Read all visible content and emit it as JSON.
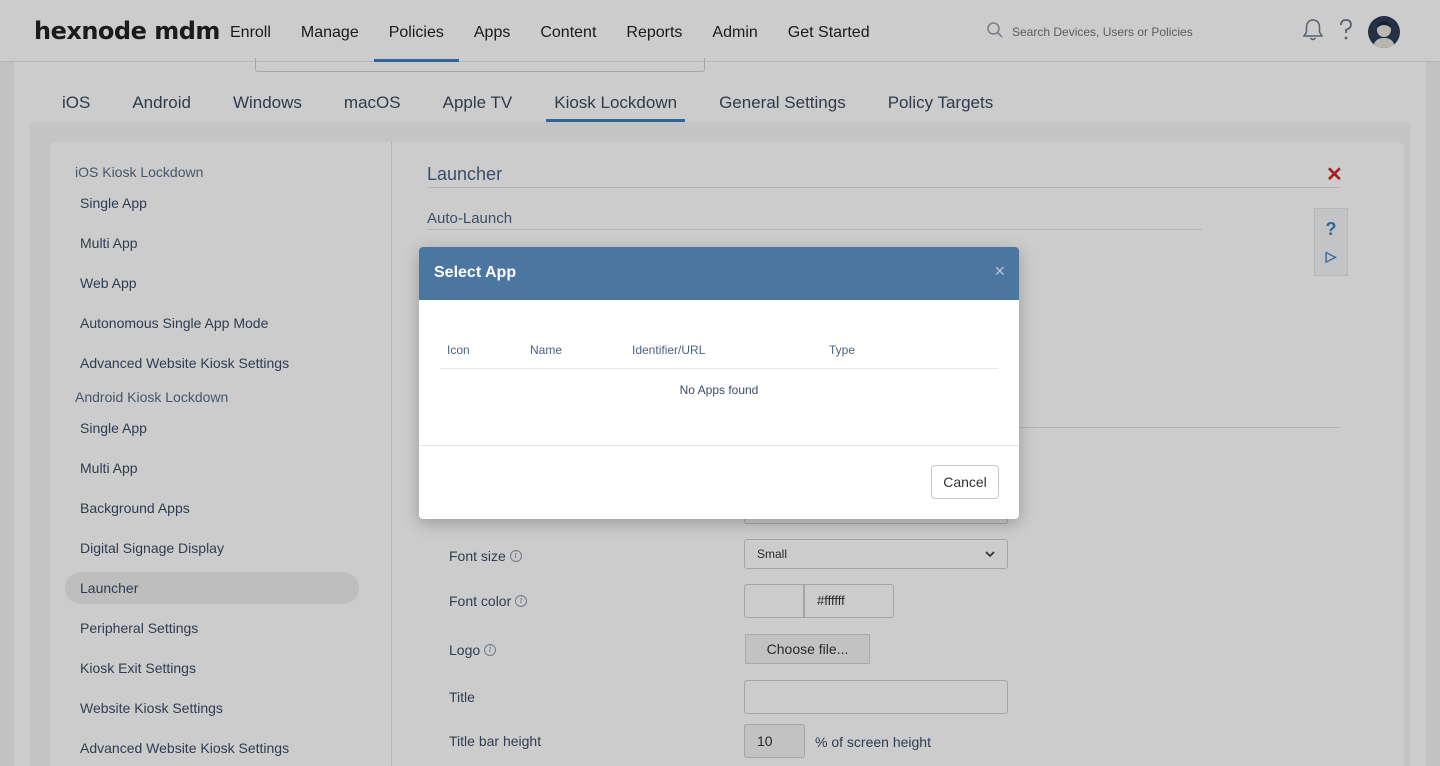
{
  "brand": {
    "logo_text": "hexnode mdm"
  },
  "nav": {
    "items": [
      {
        "label": "Enroll"
      },
      {
        "label": "Manage"
      },
      {
        "label": "Policies",
        "active": true
      },
      {
        "label": "Apps"
      },
      {
        "label": "Content"
      },
      {
        "label": "Reports"
      },
      {
        "label": "Admin"
      },
      {
        "label": "Get Started"
      }
    ],
    "search_placeholder": "Search Devices, Users or Policies",
    "icons": [
      "search-icon",
      "bell-icon",
      "help-icon",
      "avatar"
    ]
  },
  "tabs": [
    {
      "label": "iOS"
    },
    {
      "label": "Android"
    },
    {
      "label": "Windows"
    },
    {
      "label": "macOS"
    },
    {
      "label": "Apple TV"
    },
    {
      "label": "Kiosk Lockdown",
      "active": true
    },
    {
      "label": "General Settings"
    },
    {
      "label": "Policy Targets"
    }
  ],
  "sidebar": {
    "ios_group": "iOS Kiosk Lockdown",
    "ios_items": [
      "Single App",
      "Multi App",
      "Web App",
      "Autonomous Single App Mode",
      "Advanced Website Kiosk Settings"
    ],
    "android_group": "Android Kiosk Lockdown",
    "android_items": [
      "Single App",
      "Multi App",
      "Background Apps",
      "Digital Signage Display",
      "Launcher",
      "Peripheral Settings",
      "Kiosk Exit Settings",
      "Website Kiosk Settings",
      "Advanced Website Kiosk Settings"
    ],
    "active_item": "Launcher"
  },
  "main": {
    "title": "Launcher",
    "subtitle": "Auto-Launch",
    "help_icons": [
      "?",
      "▷"
    ],
    "form": {
      "font_size_label": "Font size",
      "font_size_value": "Small",
      "font_color_label": "Font color",
      "font_color_value": "#ffffff",
      "logo_label": "Logo",
      "logo_button": "Choose file...",
      "title_label": "Title",
      "title_value": "",
      "title_bar_height_label": "Title bar height",
      "title_bar_height_value": "10",
      "title_bar_height_unit": "% of screen height"
    }
  },
  "modal": {
    "title": "Select App",
    "close_glyph": "×",
    "columns": [
      "Icon",
      "Name",
      "Identifier/URL",
      "Type"
    ],
    "empty_message": "No Apps found",
    "cancel_label": "Cancel"
  },
  "colors": {
    "accent": "#3d7fc1",
    "modal_header": "#4b76a0",
    "close_red": "#cc2a2a"
  }
}
